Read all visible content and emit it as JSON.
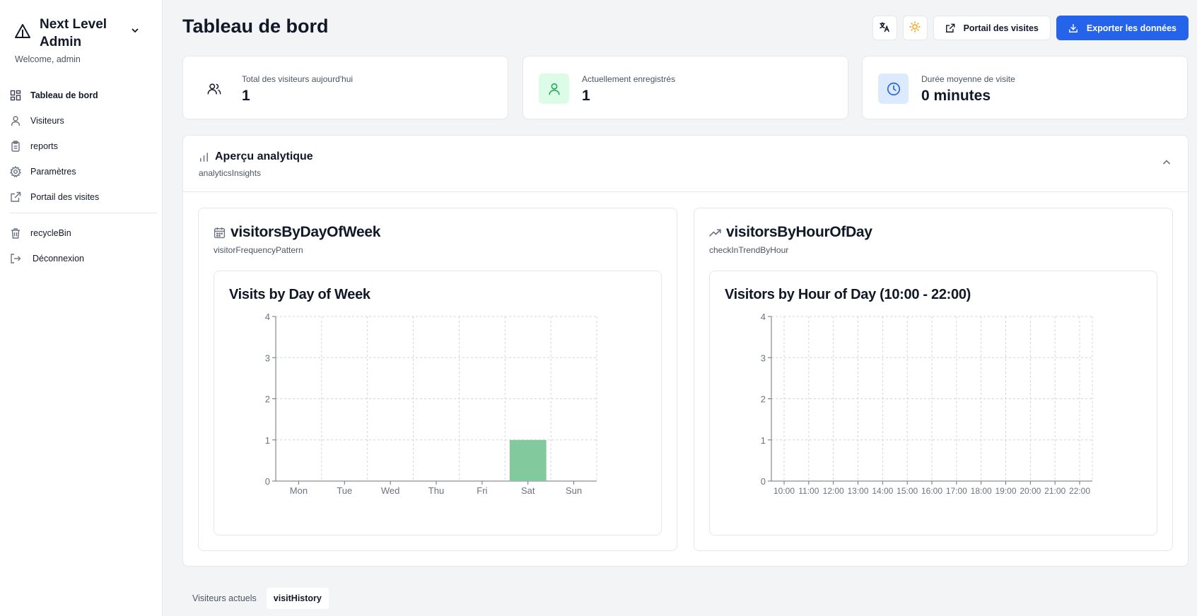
{
  "sidebar": {
    "brand": "Next Level Admin",
    "welcome": "Welcome, admin",
    "items": [
      {
        "label": "Tableau de bord",
        "icon": "dashboard-icon"
      },
      {
        "label": "Visiteurs",
        "icon": "user-icon"
      },
      {
        "label": "reports",
        "icon": "clipboard-icon"
      },
      {
        "label": "Paramètres",
        "icon": "gear-icon"
      },
      {
        "label": "Portail des visites",
        "icon": "external-link-icon"
      }
    ],
    "footer_items": [
      {
        "label": "recycleBin",
        "icon": "trash-icon"
      },
      {
        "label": "Déconnexion",
        "icon": "logout-icon"
      }
    ]
  },
  "header": {
    "title": "Tableau de bord",
    "portal_label": "Portail des visites",
    "export_label": "Exporter les données"
  },
  "stats": [
    {
      "label": "Total des visiteurs aujourd'hui",
      "value": "1",
      "icon": "users-icon"
    },
    {
      "label": "Actuellement enregistrés",
      "value": "1",
      "icon": "user-check-icon"
    },
    {
      "label": "Durée moyenne de visite",
      "value": "0 minutes",
      "icon": "clock-icon"
    }
  ],
  "analytics": {
    "title": "Aperçu analytique",
    "subtitle": "analyticsInsights"
  },
  "cards": [
    {
      "title": "visitorsByDayOfWeek",
      "subtitle": "visitorFrequencyPattern"
    },
    {
      "title": "visitorsByHourOfDay",
      "subtitle": "checkInTrendByHour"
    }
  ],
  "tabs": [
    "Visiteurs actuels",
    "visitHistory"
  ],
  "colors": {
    "accent": "#2563eb",
    "bar": "#82ca9d",
    "green_badge": "#dcfce7",
    "blue_badge": "#dbeafe"
  },
  "chart_data": [
    {
      "type": "bar",
      "title": "Visits by Day of Week",
      "categories": [
        "Mon",
        "Tue",
        "Wed",
        "Thu",
        "Fri",
        "Sat",
        "Sun"
      ],
      "values": [
        0,
        0,
        0,
        0,
        0,
        1,
        0
      ],
      "ylim": [
        0,
        4
      ],
      "yticks": [
        "0",
        "1",
        "2",
        "3",
        "4"
      ],
      "grid": true
    },
    {
      "type": "line",
      "title": "Visitors by Hour of Day (10:00 - 22:00)",
      "categories": [
        "10:00",
        "11:00",
        "12:00",
        "13:00",
        "14:00",
        "15:00",
        "16:00",
        "17:00",
        "18:00",
        "19:00",
        "20:00",
        "21:00",
        "22:00"
      ],
      "values": [
        0,
        0,
        0,
        0,
        0,
        0,
        0,
        0,
        0,
        0,
        0,
        0,
        0
      ],
      "ylim": [
        0,
        4
      ],
      "yticks": [
        "0",
        "1",
        "2",
        "3",
        "4"
      ],
      "grid": true
    }
  ]
}
